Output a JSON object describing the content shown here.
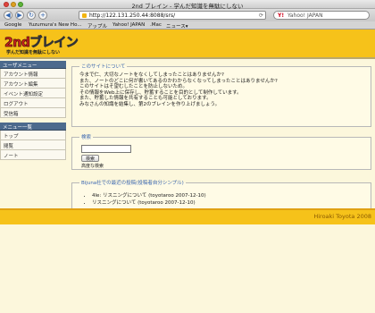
{
  "window": {
    "title": "2nd ブレイン - 学んだ知識を無駄にしない"
  },
  "toolbar": {
    "back_label": "◀",
    "forward_label": "▶",
    "reload_label": "↻",
    "add_label": "+",
    "address": "http://122.131.250.44:8088/srs/",
    "search_engine": "Y!",
    "search_placeholder": "Yahoo! JAPAN"
  },
  "bookmarks": [
    "Google",
    "Yuzumura's New Ho...",
    "アップル",
    "Yahoo! JAPAN",
    ".Mac",
    "ニュース▾"
  ],
  "site": {
    "logo_number": "2nd",
    "logo_text": "ブレイン",
    "tagline": "学んだ知識を無駄にしない"
  },
  "sidebar": {
    "user_menu_title": "ユーザメニュー",
    "user_items": [
      "アカウント情報",
      "アカウント編集",
      "イベント通知設定",
      "ログアウト",
      "受信箱"
    ],
    "main_menu_title": "メニュー一覧",
    "main_items": [
      "トップ",
      "閲覧",
      "ノート"
    ]
  },
  "about": {
    "legend": "このサイトについて",
    "lines": [
      "今まで仁、大切なノートをなくしてしまったことはありませんか?",
      "また、ノートのどこに何が書いてあるのかわからなくなってしまったことはありませんか?",
      "このサイトはそ望むしたことを防止しないため。",
      "その情報をWeb上に保存し、貯蓄することを目的として制作しています。",
      "また、貯蓄した情報を共有することも可能としております。",
      "みなさんの知識を結集し、第2のブレインを作り上げましょう。"
    ]
  },
  "search": {
    "legend": "検索",
    "value": "",
    "button_label": "検索",
    "advanced_link": "高度な検索"
  },
  "recent": {
    "legend": "Bijuna社での最近の投稿(投稿者自分シンプル)",
    "posts": [
      "4le: リスニングについて (toyotaroo 2007-12-10)",
      "リスニングについて (toyotaroo 2007-12-10)"
    ]
  },
  "footer": {
    "copyright": "Hiroaki Toyota 2008"
  }
}
